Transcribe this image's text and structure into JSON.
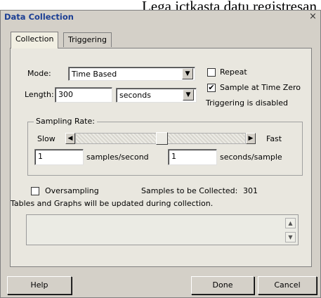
{
  "caption_text": "Lega ictkasta datu registresan",
  "window": {
    "title": "Data Collection",
    "close_label": "×"
  },
  "tabs": [
    {
      "label": "Collection",
      "active": true
    },
    {
      "label": "Triggering",
      "active": false
    }
  ],
  "collection": {
    "mode_label": "Mode:",
    "mode_value": "Time Based",
    "length_label": "Length:",
    "length_value": "300",
    "unit_value": "seconds",
    "repeat_label": "Repeat",
    "repeat_checked": false,
    "sample_at_zero_label": "Sample at Time Zero",
    "sample_at_zero_checked": true,
    "triggering_status": "Triggering is disabled",
    "sampling_rate": {
      "title": "Sampling Rate:",
      "slow_label": "Slow",
      "fast_label": "Fast",
      "samples_per_second_value": "1",
      "samples_per_second_label": "samples/second",
      "seconds_per_sample_value": "1",
      "seconds_per_sample_label": "seconds/sample"
    },
    "oversampling_label": "Oversampling",
    "oversampling_checked": false,
    "samples_to_collect_label": "Samples to be Collected:",
    "samples_to_collect_value": "301",
    "update_note": "Tables and Graphs will be updated during collection."
  },
  "buttons": {
    "help": "Help",
    "done": "Done",
    "cancel": "Cancel"
  },
  "icons": {
    "dropdown": "chevron-down-icon",
    "scroll_left": "triangle-left-icon",
    "scroll_right": "triangle-right-icon",
    "scroll_up": "triangle-up-icon",
    "scroll_down": "triangle-down-icon",
    "check": "checkmark-icon"
  }
}
